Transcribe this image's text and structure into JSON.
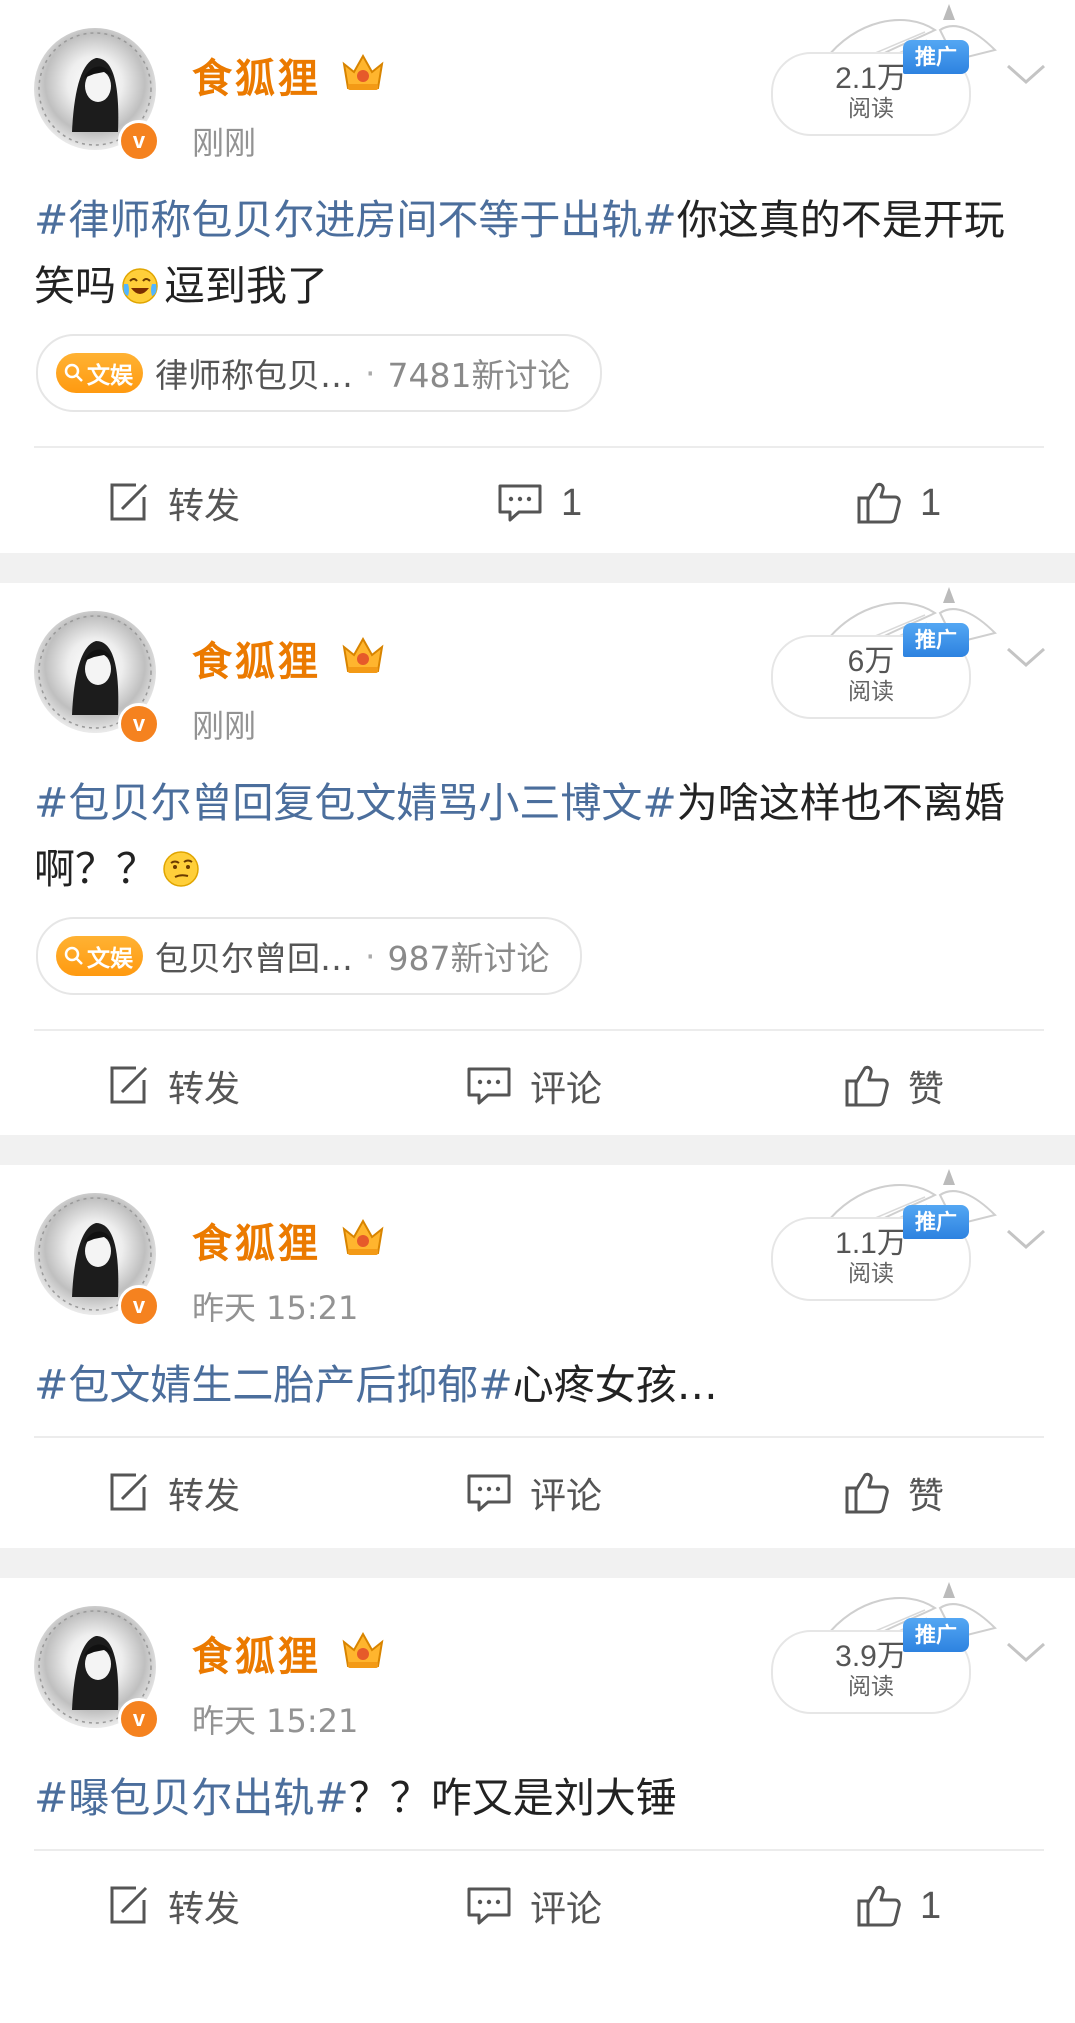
{
  "posts": [
    {
      "username": "食狐狸",
      "time": "刚刚",
      "reads": {
        "count": "2.1万",
        "label": "阅读"
      },
      "promo": "推广",
      "hashtag": "#律师称包贝尔进房间不等于出轨#",
      "text1": "你这真的不是开玩笑吗",
      "emoji": "crying-laughing-emoji",
      "text2": "逗到我了",
      "topic": {
        "badge": "文娱",
        "name": "律师称包贝…",
        "dot": "·",
        "count": "7481新讨论"
      },
      "actions": {
        "repost": "转发",
        "comment": "1",
        "like": "1"
      }
    },
    {
      "username": "食狐狸",
      "time": "刚刚",
      "reads": {
        "count": "6万",
        "label": "阅读"
      },
      "promo": "推广",
      "hashtag": "#包贝尔曾回复包文婧骂小三博文#",
      "text1": "为啥这样也不离婚啊？？",
      "emoji": "thinking-emoji",
      "topic": {
        "badge": "文娱",
        "name": "包贝尔曾回…",
        "dot": "·",
        "count": "987新讨论"
      },
      "actions": {
        "repost": "转发",
        "comment": "评论",
        "like": "赞"
      }
    },
    {
      "username": "食狐狸",
      "time": "昨天 15:21",
      "reads": {
        "count": "1.1万",
        "label": "阅读"
      },
      "promo": "推广",
      "hashtag": "#包文婧生二胎产后抑郁#",
      "text1": "心疼女孩…",
      "actions": {
        "repost": "转发",
        "comment": "评论",
        "like": "赞"
      }
    },
    {
      "username": "食狐狸",
      "time": "昨天 15:21",
      "reads": {
        "count": "3.9万",
        "label": "阅读"
      },
      "promo": "推广",
      "hashtag": "#曝包贝尔出轨#",
      "text1": "？？咋又是刘大锤",
      "actions": {
        "repost": "转发",
        "comment": "评论",
        "like": "1"
      }
    }
  ],
  "colors": {
    "username": "#eb7a00",
    "hashtag": "#4b6e9c",
    "promo": "#2d82e0",
    "verified": "#f5821f",
    "topic_badge": "#ff9a10",
    "background": "#f1f1f1"
  },
  "icons": {
    "verified": "v-badge",
    "vip": "crown-icon",
    "more": "chevron-down-icon",
    "repost": "repost-icon",
    "comment": "comment-icon",
    "like": "thumbs-up-icon",
    "topic": "search-icon"
  }
}
